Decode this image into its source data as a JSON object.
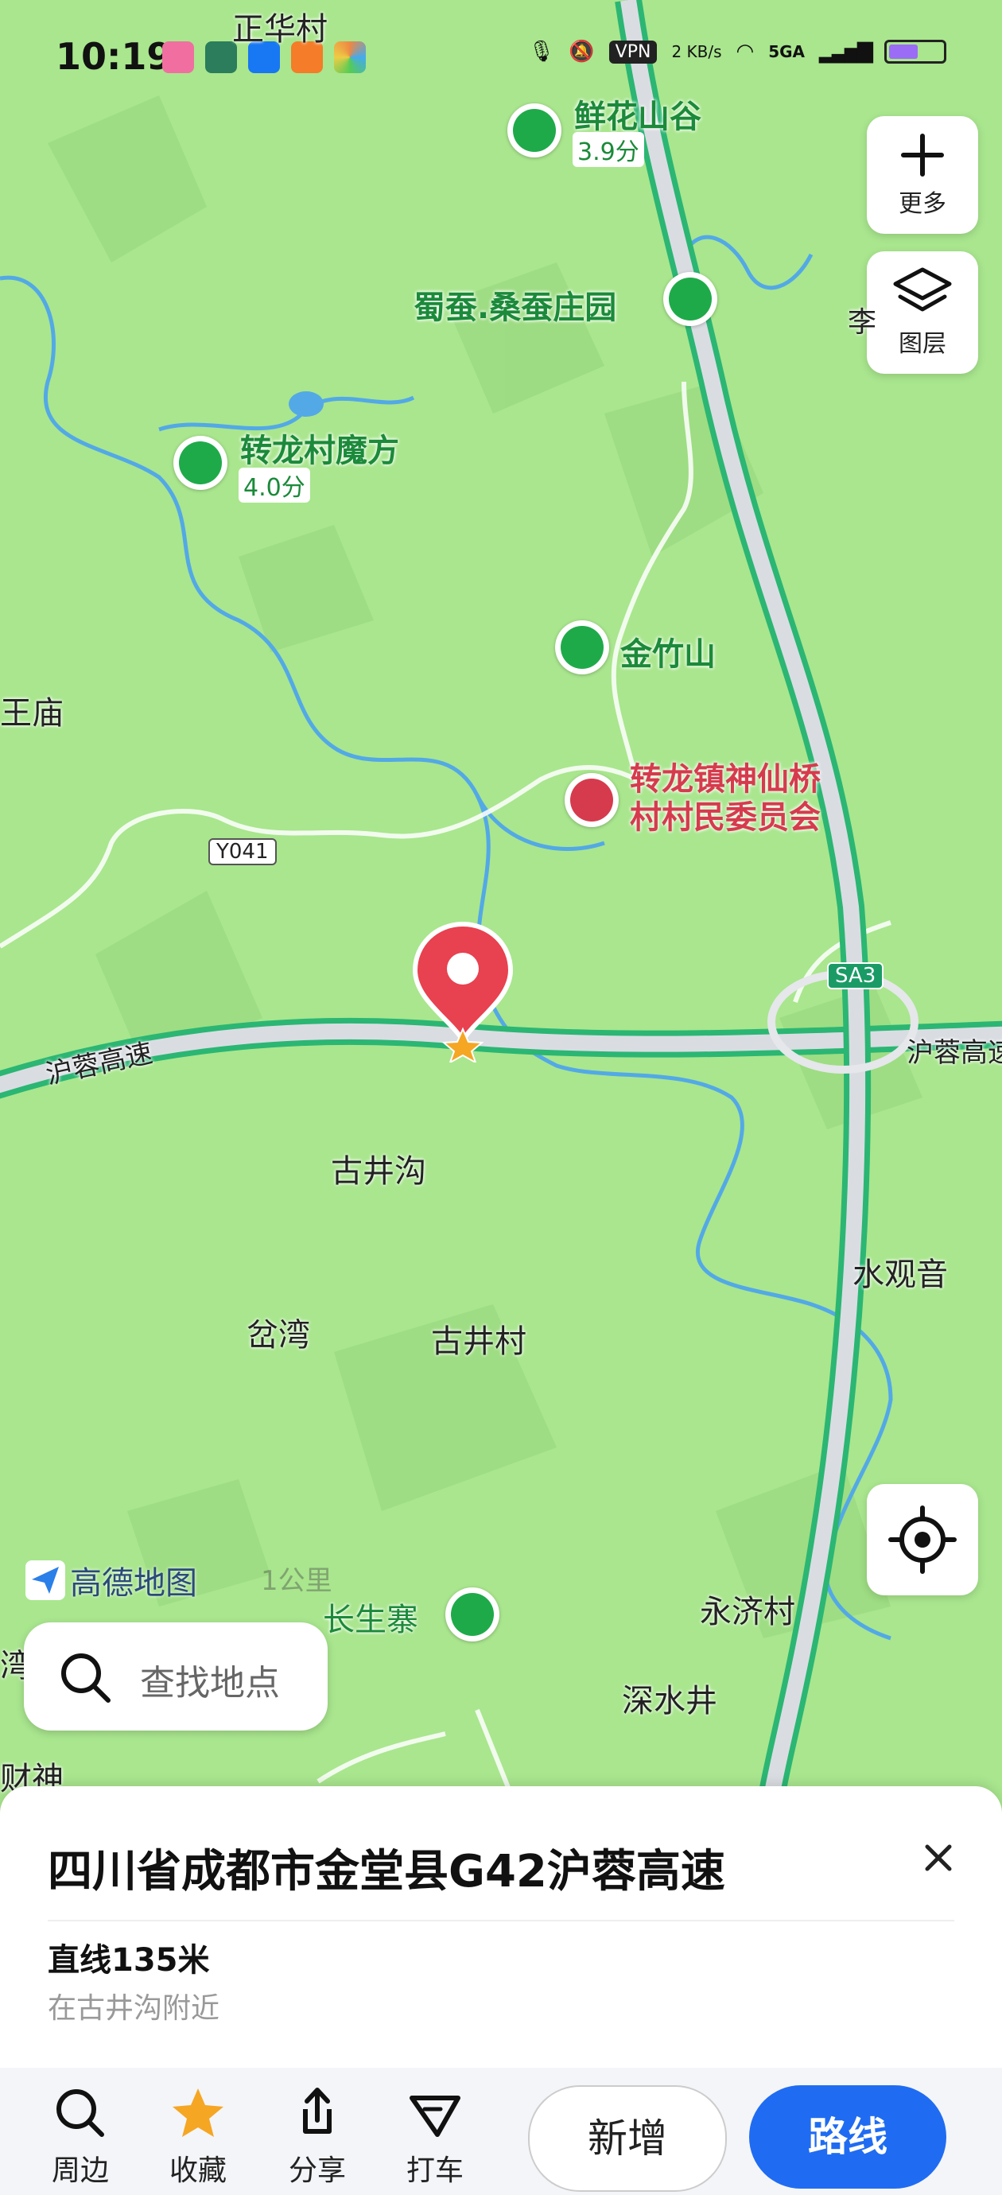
{
  "status_bar": {
    "time": "10:19",
    "carrier_text": "5GA",
    "speed": "2 KB/s",
    "vpn": "VPN",
    "battery_level": 0.55,
    "top_place": "正华村"
  },
  "map": {
    "labels": {
      "top_village": "正华村",
      "wangmiao": "王庙",
      "gujinggou": "古井沟",
      "chawan": "岔湾",
      "gujingcun": "古井村",
      "shuiguanyin": "水观音",
      "yongjicun": "永济村",
      "shenshuijing": "深水井",
      "caishen": "财神",
      "wan": "湾",
      "li": "李"
    },
    "pois": {
      "xianhua": {
        "name": "鲜花山谷",
        "rating": "3.9分"
      },
      "shucan": {
        "name": "蜀蚕.桑蚕庄园"
      },
      "zhuanlong": {
        "name": "转龙村魔方",
        "rating": "4.0分"
      },
      "jinzhu": {
        "name": "金竹山"
      },
      "committee": {
        "line1": "转龙镇神仙桥",
        "line2": "村村民委员会"
      },
      "changsheng": {
        "name": "长生寨"
      }
    },
    "roads": {
      "y041": "Y041",
      "sa3": "SA3",
      "hurong_left": "沪蓉高速",
      "hurong_right": "沪蓉高速"
    },
    "brand": "高德地图",
    "scale": "1公里"
  },
  "controls": {
    "more_label": "更多",
    "layers_label": "图层"
  },
  "search": {
    "placeholder": "查找地点"
  },
  "panel": {
    "title": "四川省成都市金堂县G42沪蓉高速",
    "distance": "直线135米",
    "nearby": "在古井沟附近",
    "actions": {
      "nearby": "周边",
      "favorite": "收藏",
      "share": "分享",
      "taxi": "打车"
    },
    "add_button": "新增",
    "route_button": "路线"
  },
  "colors": {
    "map_bg": "#a9e68e",
    "highway": "#2bb673",
    "route_blue": "#1f6cf2",
    "poi_green": "#1faa4a",
    "poi_red": "#d63b4d"
  }
}
